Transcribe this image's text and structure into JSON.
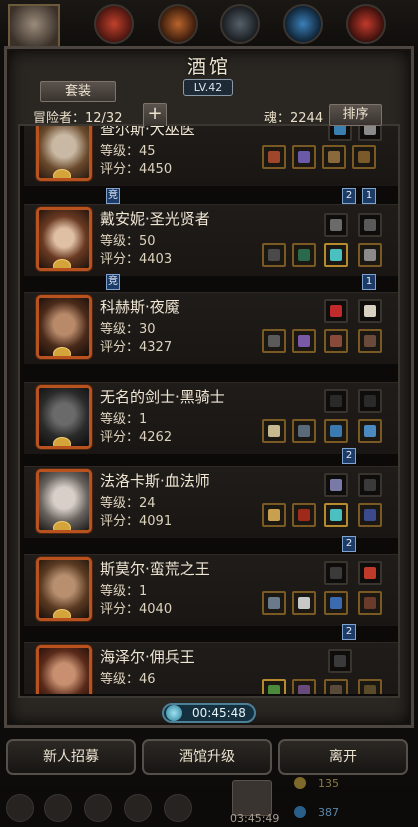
{
  "header": {
    "title": "酒馆",
    "level": "LV.42",
    "set_label": "套装",
    "adventurer_count": "冒险者：12/32",
    "add_icon": "plus-icon",
    "souls": "魂：2244",
    "sort_label": "排序"
  },
  "heroes": [
    {
      "name": "查尔斯·大巫医",
      "level": "等级：45",
      "score": "评分：4450"
    },
    {
      "name": "戴安妮·圣光贤者",
      "level": "等级：50",
      "score": "评分：4403"
    },
    {
      "name": "科赫斯·夜魇",
      "level": "等级：30",
      "score": "评分：4327"
    },
    {
      "name": "无名的剑士·黑骑士",
      "level": "等级：1",
      "score": "评分：4262"
    },
    {
      "name": "法洛卡斯·血法师",
      "level": "等级：24",
      "score": "评分：4091"
    },
    {
      "name": "斯莫尔·蛮荒之王",
      "level": "等级：1",
      "score": "评分：4040"
    },
    {
      "name": "海泽尔·佣兵王",
      "level": "等级：46",
      "score": ""
    }
  ],
  "badges": {
    "compete": "竞",
    "two": "2",
    "one": "1"
  },
  "timer": "00:45:48",
  "actions": {
    "recruit": "新人招募",
    "upgrade": "酒馆升级",
    "leave": "离开"
  },
  "footer": {
    "time": "03:45:49",
    "coins": "135",
    "gems": "387"
  },
  "colors": {
    "portrait_border": "#b8521e",
    "badge_blue": "#1c3b66",
    "timer_teal": "#4d7f96"
  }
}
